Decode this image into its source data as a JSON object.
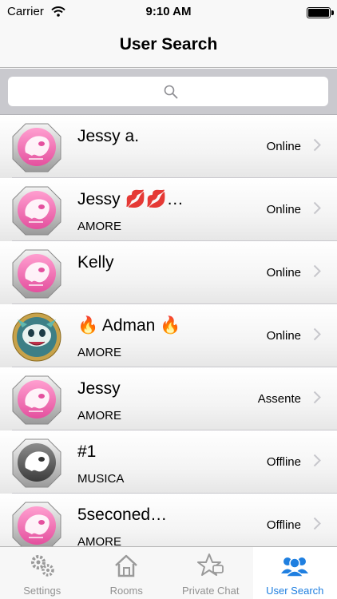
{
  "status_bar": {
    "carrier": "Carrier",
    "time": "9:10 AM",
    "battery_level": 1.0
  },
  "nav": {
    "title": "User Search"
  },
  "search": {
    "placeholder": ""
  },
  "users": [
    {
      "name": "Jessy a.",
      "subtitle": "",
      "status": "Online",
      "avatar": "pink-alien-badge-icon"
    },
    {
      "name": "Jessy 💋💋…",
      "subtitle": "AMORE",
      "status": "Online",
      "avatar": "pink-alien-badge-icon"
    },
    {
      "name": "Kelly",
      "subtitle": "",
      "status": "Online",
      "avatar": "pink-alien-badge-icon"
    },
    {
      "name": "🔥 Adman 🔥",
      "subtitle": "AMORE",
      "status": "Online",
      "avatar": "teal-creature-icon"
    },
    {
      "name": "Jessy",
      "subtitle": "AMORE",
      "status": "Assente",
      "avatar": "pink-alien-badge-icon"
    },
    {
      "name": "#1",
      "subtitle": "MUSICA",
      "status": "Offline",
      "avatar": "gray-alien-badge-icon"
    },
    {
      "name": "5seconed…",
      "subtitle": "AMORE",
      "status": "Offline",
      "avatar": "pink-alien-badge-icon"
    }
  ],
  "tabs": [
    {
      "label": "Settings",
      "icon": "gears-icon",
      "active": false
    },
    {
      "label": "Rooms",
      "icon": "house-icon",
      "active": false
    },
    {
      "label": "Private Chat",
      "icon": "star-chat-icon",
      "active": false
    },
    {
      "label": "User Search",
      "icon": "users-icon",
      "active": true
    }
  ],
  "colors": {
    "accent": "#1f7fe0",
    "avatar_pink": "#f06ab3",
    "avatar_gray": "#6b6b6b",
    "avatar_teal": "#5fb8b0"
  }
}
